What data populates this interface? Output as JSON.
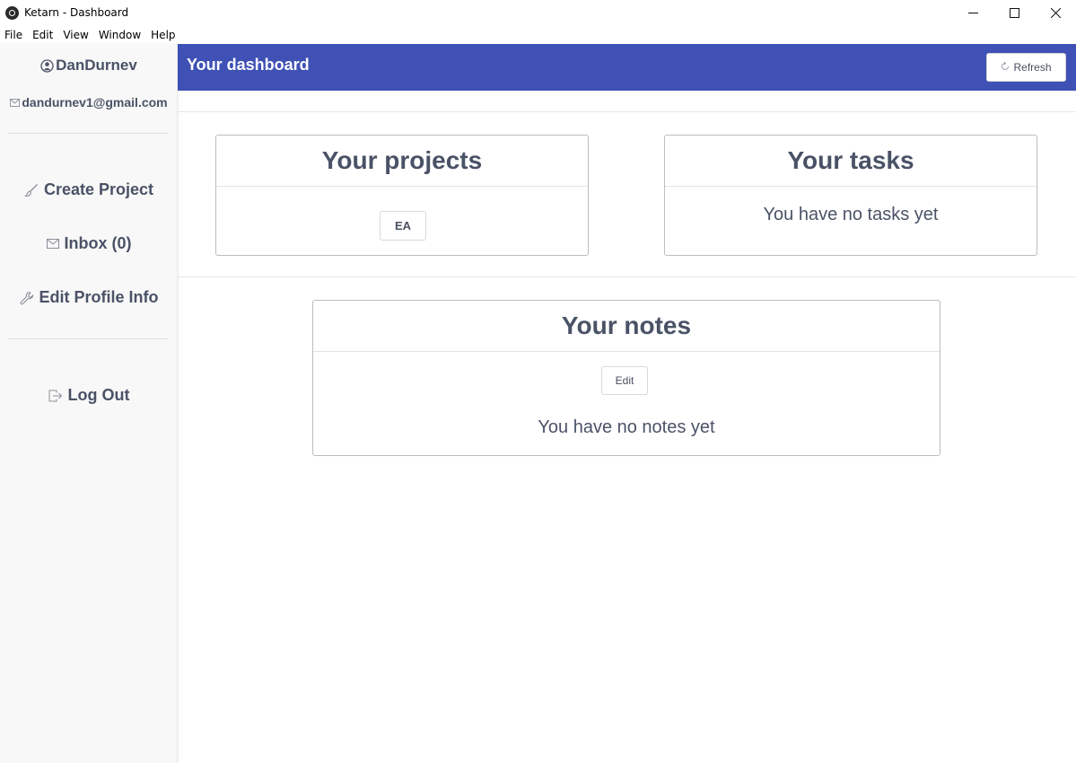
{
  "window": {
    "title": "Ketarn - Dashboard",
    "minimize_glyph": "—",
    "maximize_glyph": "☐",
    "close_glyph": "✕"
  },
  "menu": [
    "File",
    "Edit",
    "View",
    "Window",
    "Help"
  ],
  "sidebar": {
    "username": "DanDurnev",
    "email": "dandurnev1@gmail.com",
    "nav": [
      {
        "label": "Create Project",
        "icon": "brush-icon"
      },
      {
        "label": "Inbox (0)",
        "icon": "envelope-icon"
      },
      {
        "label": "Edit Profile Info",
        "icon": "wrench-icon"
      }
    ],
    "logout_label": "Log Out"
  },
  "header": {
    "title": "Your dashboard",
    "refresh_label": "Refresh",
    "color": "#3f51b5"
  },
  "projects": {
    "title": "Your projects",
    "items": [
      "EA"
    ]
  },
  "tasks": {
    "title": "Your tasks",
    "empty_message": "You have no tasks yet"
  },
  "notes": {
    "title": "Your notes",
    "edit_label": "Edit",
    "empty_message": "You have no notes yet"
  }
}
